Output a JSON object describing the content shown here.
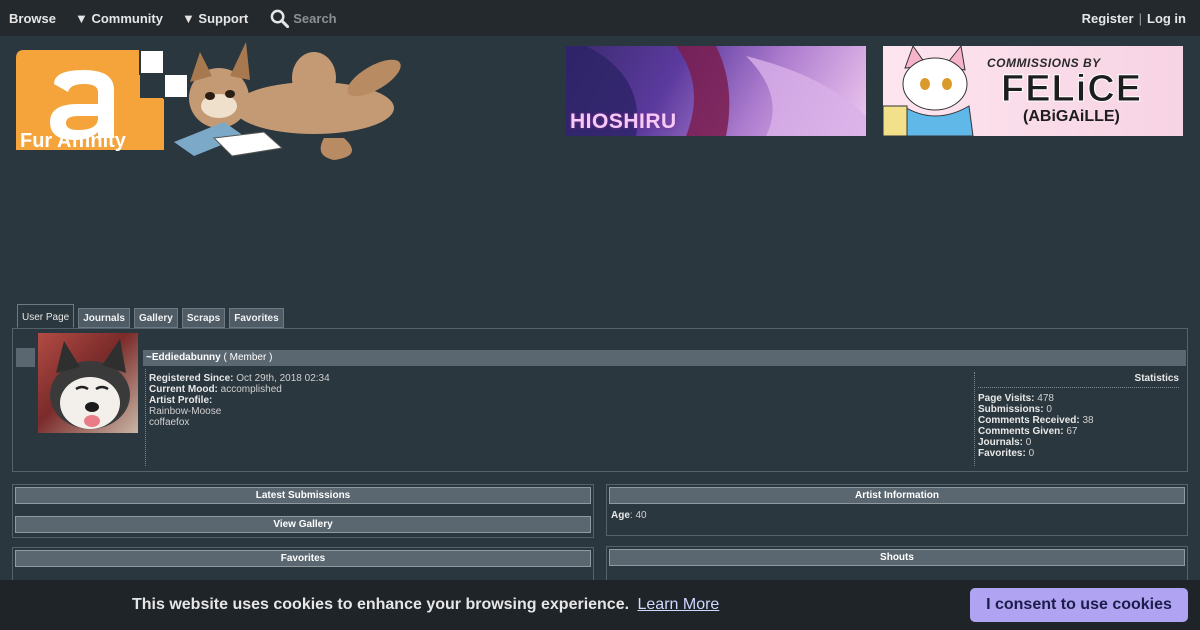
{
  "nav": {
    "browse": "Browse",
    "community": "▼ Community",
    "support": "▼ Support",
    "search_placeholder": "Search",
    "register": "Register",
    "separator": "|",
    "login": "Log in"
  },
  "logo": {
    "text": "Fur Affinity"
  },
  "banners": [
    {
      "label": "HIOSHIRU"
    },
    {
      "line1": "COMMISSIONS BY",
      "line2": "FELiCE",
      "line3": "(ABiGAiLLE)"
    }
  ],
  "tabs": [
    "User Page",
    "Journals",
    "Gallery",
    "Scraps",
    "Favorites"
  ],
  "profile": {
    "username": "~Eddiedabunny",
    "role": "( Member )",
    "registered_label": "Registered Since:",
    "registered_value": "Oct 29th, 2018 02:34",
    "mood_label": "Current Mood:",
    "mood_value": "accomplished",
    "artist_profile_label": "Artist Profile:",
    "artist_profile_lines": [
      "Rainbow-Moose",
      "coffaefox"
    ]
  },
  "statistics": {
    "title": "Statistics",
    "rows": [
      {
        "label": "Page Visits:",
        "value": "478"
      },
      {
        "label": "Submissions:",
        "value": "0"
      },
      {
        "label": "Comments Received:",
        "value": "38"
      },
      {
        "label": "Comments Given:",
        "value": "67"
      },
      {
        "label": "Journals:",
        "value": "0"
      },
      {
        "label": "Favorites:",
        "value": "0"
      }
    ]
  },
  "panels": {
    "latest_submissions": "Latest Submissions",
    "view_gallery": "View Gallery",
    "favorites": "Favorites",
    "artist_information": "Artist Information",
    "age_label": "Age",
    "age_value": "40",
    "shouts": "Shouts"
  },
  "cookie": {
    "message": "This website uses cookies to enhance your browsing experience.",
    "link": "Learn More",
    "button": "I consent to use cookies"
  },
  "colors": {
    "page_bg": "#2b373e",
    "nav_bg": "#23292d",
    "section_bar": "#5a6770",
    "logo_orange": "#f4a43b",
    "cookie_button": "#b0a4f2"
  }
}
